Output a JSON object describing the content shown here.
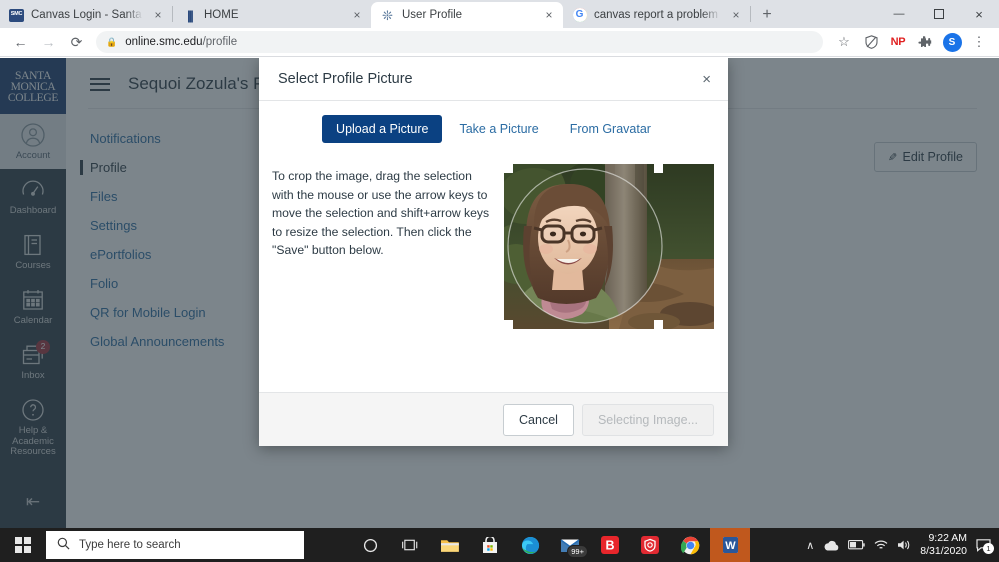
{
  "browser": {
    "tabs": [
      {
        "title": "Canvas Login - Santa Monica Col",
        "favicon": "smc-icon",
        "active": false
      },
      {
        "title": "HOME",
        "favicon": "smc-logo-icon",
        "active": false
      },
      {
        "title": "User Profile",
        "favicon": "canvas-icon",
        "active": true
      },
      {
        "title": "canvas report a problem - Googl",
        "favicon": "google-icon",
        "active": false
      }
    ],
    "new_tab_label": "+",
    "close_label": "×",
    "window_controls": {
      "minimize": "—",
      "maximize": "❐",
      "close": "×"
    },
    "nav": {
      "back": "←",
      "forward": "→",
      "reload": "⟳"
    },
    "omnibox": {
      "lock": "🔒",
      "host": "online.smc.edu",
      "path": "/profile"
    },
    "toolbar_icons": [
      {
        "name": "bookmark-star-icon",
        "glyph": "☆"
      },
      {
        "name": "shield-icon",
        "glyph": "⛉"
      },
      {
        "name": "np-extension-icon",
        "glyph": "NP"
      },
      {
        "name": "extensions-puzzle-icon",
        "glyph": "❖"
      }
    ],
    "profile_initial": "S",
    "menu_glyph": "⋮"
  },
  "canvas_nav": {
    "logo_lines": [
      "SANTA",
      "MONICA",
      "COLLEGE"
    ],
    "items": [
      {
        "label": "Account",
        "icon": "user-avatar-icon",
        "active": true,
        "badge": ""
      },
      {
        "label": "Dashboard",
        "icon": "dashboard-gauge-icon",
        "active": false,
        "badge": ""
      },
      {
        "label": "Courses",
        "icon": "courses-book-icon",
        "active": false,
        "badge": ""
      },
      {
        "label": "Calendar",
        "icon": "calendar-icon",
        "active": false,
        "badge": ""
      },
      {
        "label": "Inbox",
        "icon": "inbox-icon",
        "active": false,
        "badge": "2"
      },
      {
        "label": "Help & Academic Resources",
        "icon": "help-question-icon",
        "active": false,
        "badge": ""
      }
    ],
    "collapse_label": "⇤"
  },
  "page": {
    "title": "Sequoi Zozula's Profile",
    "menu_icon": "hamburger-icon",
    "edit_profile": {
      "label": "Edit Profile",
      "icon": "pencil-icon",
      "glyph": "✎"
    },
    "profile_links": [
      {
        "label": "Notifications",
        "active": false
      },
      {
        "label": "Profile",
        "active": true
      },
      {
        "label": "Files",
        "active": false
      },
      {
        "label": "Settings",
        "active": false
      },
      {
        "label": "ePortfolios",
        "active": false
      },
      {
        "label": "Folio",
        "active": false
      },
      {
        "label": "QR for Mobile Login",
        "active": false
      },
      {
        "label": "Global Announcements",
        "active": false
      }
    ]
  },
  "modal": {
    "title": "Select Profile Picture",
    "close_glyph": "×",
    "tabs": [
      {
        "label": "Upload a Picture",
        "selected": true
      },
      {
        "label": "Take a Picture",
        "selected": false
      },
      {
        "label": "From Gravatar",
        "selected": false
      }
    ],
    "instructions": "To crop the image, drag the selection with the mouse or use the arrow keys to move the selection and shift+arrow keys to resize the selection. Then click the \"Save\" button below.",
    "image_alt": "photo of a smiling person with glasses standing in a redwood forest",
    "buttons": {
      "cancel": "Cancel",
      "submit": "Selecting Image..."
    }
  },
  "taskbar": {
    "start": "start-button",
    "search_placeholder": "Type here to search",
    "apps": [
      {
        "name": "cortana-icon",
        "badge": ""
      },
      {
        "name": "task-view-icon",
        "badge": ""
      },
      {
        "name": "file-explorer-icon",
        "badge": ""
      },
      {
        "name": "microsoft-store-icon",
        "badge": ""
      },
      {
        "name": "microsoft-edge-icon",
        "badge": ""
      },
      {
        "name": "mail-icon",
        "badge": "99+"
      },
      {
        "name": "bitwarden-icon",
        "badge": ""
      },
      {
        "name": "antivirus-shield-icon",
        "badge": ""
      },
      {
        "name": "google-chrome-icon",
        "badge": ""
      },
      {
        "name": "microsoft-word-icon",
        "badge": ""
      }
    ],
    "tray": {
      "overflow": "∧",
      "onedrive": "onedrive-icon",
      "battery": "battery-icon",
      "wifi": "wifi-icon",
      "volume": "volume-icon",
      "time": "9:22 AM",
      "date": "8/31/2020",
      "notification_count": "1"
    }
  }
}
